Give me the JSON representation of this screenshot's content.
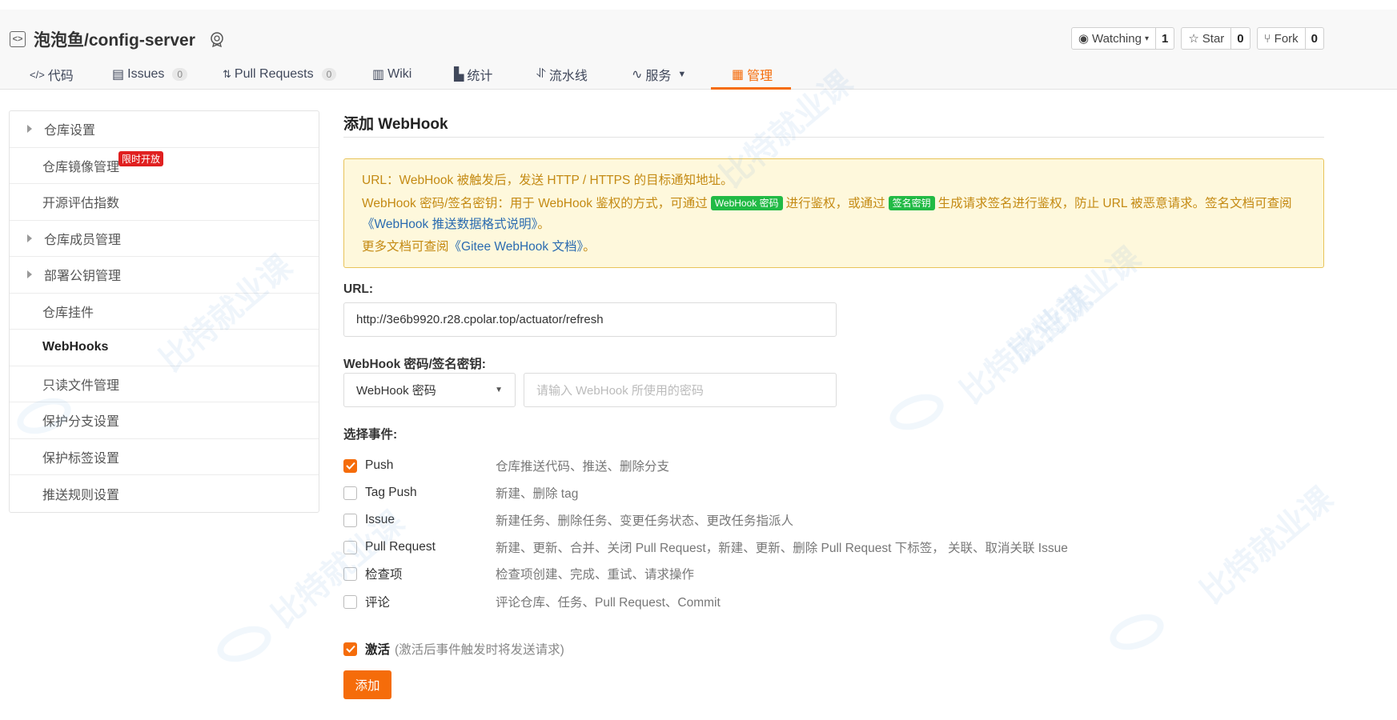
{
  "repo": {
    "title": "泡泡鱼/config-server",
    "watch": {
      "label": "Watching",
      "count": "1"
    },
    "star": {
      "label": "Star",
      "count": "0"
    },
    "fork": {
      "label": "Fork",
      "count": "0"
    }
  },
  "tabs": [
    {
      "label": "代码",
      "icon": "code-icon"
    },
    {
      "label": "Issues",
      "count": "0",
      "icon": "issues-icon"
    },
    {
      "label": "Pull Requests",
      "count": "0",
      "icon": "pull-request-icon"
    },
    {
      "label": "Wiki",
      "icon": "wiki-icon"
    },
    {
      "label": "统计",
      "icon": "stats-icon"
    },
    {
      "label": "流水线",
      "icon": "pipeline-icon"
    },
    {
      "label": "服务",
      "icon": "service-icon"
    },
    {
      "label": "管理",
      "icon": "manage-icon",
      "active": true
    }
  ],
  "sidebar": {
    "items": [
      {
        "label": "仓库设置",
        "caret": true
      },
      {
        "label": "仓库镜像管理",
        "badge": "限时开放"
      },
      {
        "label": "开源评估指数"
      },
      {
        "label": "仓库成员管理",
        "caret": true
      },
      {
        "label": "部署公钥管理",
        "caret": true
      },
      {
        "label": "仓库挂件"
      },
      {
        "label": "WebHooks",
        "active": true
      },
      {
        "label": "只读文件管理"
      },
      {
        "label": "保护分支设置"
      },
      {
        "label": "保护标签设置"
      },
      {
        "label": "推送规则设置"
      }
    ]
  },
  "main": {
    "title": "添加 WebHook",
    "notice": {
      "line1": "URL：WebHook 被触发后，发送 HTTP / HTTPS 的目标通知地址。",
      "line2_a": "WebHook 密码/签名密钥：用于 WebHook 鉴权的方式，可通过",
      "line2_tag1": "WebHook 密码",
      "line2_b": "进行鉴权，或通过",
      "line2_tag2": "签名密钥",
      "line2_c": "生成请求签名进行鉴权，防止 URL 被恶意请求。签名文档可查阅",
      "line3_link": "《WebHook 推送数据格式说明》",
      "line3_end": "。",
      "line4_a": "更多文档可查阅",
      "line4_link": "《Gitee WebHook 文档》",
      "line4_end": "。"
    },
    "url_label": "URL:",
    "url_value": "http://3e6b9920.r28.cpolar.top/actuator/refresh",
    "secret_label": "WebHook 密码/签名密钥:",
    "secret_select": "WebHook 密码",
    "secret_placeholder": "请输入 WebHook 所使用的密码",
    "events_label": "选择事件:",
    "events": [
      {
        "name": "Push",
        "desc": "仓库推送代码、推送、删除分支",
        "checked": true
      },
      {
        "name": "Tag Push",
        "desc": "新建、删除 tag",
        "checked": false
      },
      {
        "name": "Issue",
        "desc": "新建任务、删除任务、变更任务状态、更改任务指派人",
        "checked": false
      },
      {
        "name": "Pull Request",
        "desc": "新建、更新、合并、关闭 Pull Request，新建、更新、删除 Pull Request 下标签， 关联、取消关联 Issue",
        "checked": false
      },
      {
        "name": "检查项",
        "desc": "检查项创建、完成、重试、请求操作",
        "checked": false
      },
      {
        "name": "评论",
        "desc": "评论仓库、任务、Pull Request、Commit",
        "checked": false
      }
    ],
    "activate_label": "激活",
    "activate_hint": "(激活后事件触发时将发送请求)",
    "activate_checked": true,
    "add_button": "添加"
  },
  "colors": {
    "accent": "#f56c0a",
    "notice_bg": "#fef8dc",
    "notice_text": "#c48a13",
    "tag_green": "#21ba45",
    "badge_red": "#e02020"
  }
}
